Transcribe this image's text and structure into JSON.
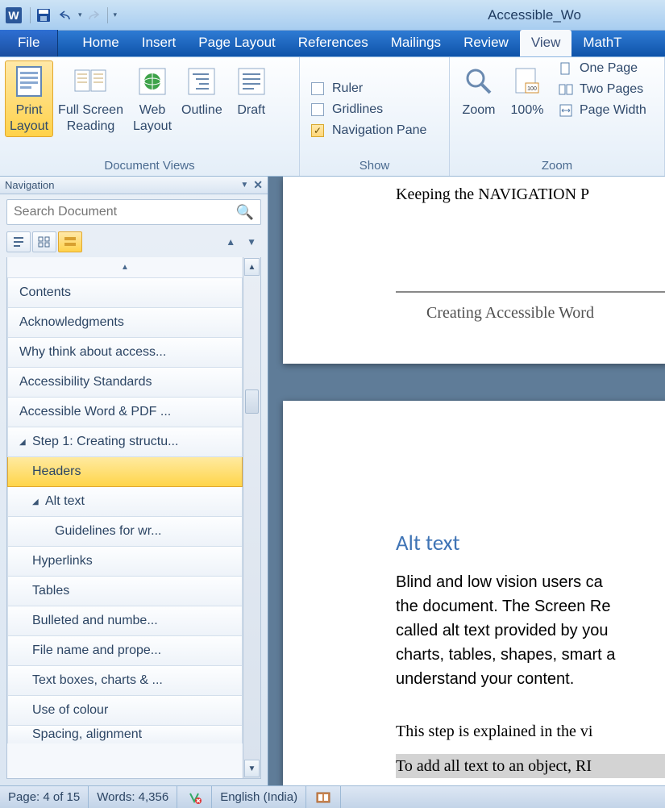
{
  "title": "Accessible_Wo",
  "tabs": {
    "file": "File",
    "home": "Home",
    "insert": "Insert",
    "pagelayout": "Page Layout",
    "references": "References",
    "mailings": "Mailings",
    "review": "Review",
    "view": "View",
    "mathtype": "MathT"
  },
  "ribbon": {
    "views": {
      "group_label": "Document Views",
      "print_layout": "Print\nLayout",
      "full_screen": "Full Screen\nReading",
      "web_layout": "Web\nLayout",
      "outline": "Outline",
      "draft": "Draft"
    },
    "show": {
      "group_label": "Show",
      "ruler": "Ruler",
      "gridlines": "Gridlines",
      "navpane": "Navigation Pane"
    },
    "zoom": {
      "group_label": "Zoom",
      "zoom": "Zoom",
      "hundred": "100%",
      "one_page": "One Page",
      "two_pages": "Two Pages",
      "page_width": "Page Width"
    }
  },
  "navpane": {
    "title": "Navigation",
    "search_placeholder": "Search Document",
    "items": [
      {
        "label": "Contents",
        "level": 1
      },
      {
        "label": "Acknowledgments",
        "level": 1
      },
      {
        "label": "Why think about access...",
        "level": 1
      },
      {
        "label": "Accessibility Standards",
        "level": 1
      },
      {
        "label": "Accessible Word & PDF ...",
        "level": 1
      },
      {
        "label": "Step 1: Creating structu...",
        "level": 1,
        "expanded": true
      },
      {
        "label": "Headers",
        "level": 2,
        "selected": true
      },
      {
        "label": "Alt text",
        "level": 2,
        "expanded": true
      },
      {
        "label": "Guidelines for wr...",
        "level": 3
      },
      {
        "label": "Hyperlinks",
        "level": 2
      },
      {
        "label": "Tables",
        "level": 2
      },
      {
        "label": "Bulleted and numbe...",
        "level": 2
      },
      {
        "label": "File name and prope...",
        "level": 2
      },
      {
        "label": "Text boxes, charts & ...",
        "level": 2
      },
      {
        "label": "Use of colour",
        "level": 2
      },
      {
        "label": "Spacing, alignment",
        "level": 2,
        "partial": true
      }
    ]
  },
  "doc": {
    "p1_line1": "Keeping the NAVIGATION P",
    "p1_subtitle": "Creating Accessible Word ",
    "p2_heading": "Alt text",
    "p2_para1_l1": "Blind and low vision users ca",
    "p2_para1_l2": "the document. The Screen Re",
    "p2_para1_l3": "called alt text provided by you",
    "p2_para1_l4": "charts, tables, shapes, smart a",
    "p2_para1_l5": "understand your content.",
    "p2_para2": "This step is explained in the vi",
    "p2_para3": "To add all text to an object, RI"
  },
  "status": {
    "page": "Page: 4 of 15",
    "words": "Words: 4,356",
    "lang": "English (India)"
  }
}
